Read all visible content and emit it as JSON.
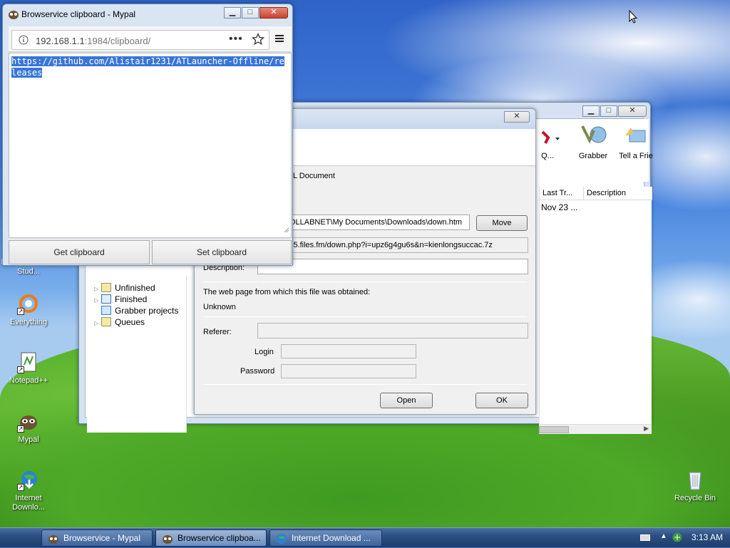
{
  "desktop": {
    "icons": [
      {
        "label": "Microsoft Visual Stud...",
        "icon": "visual-studio-icon"
      },
      {
        "label": "Everything",
        "icon": "everything-icon"
      },
      {
        "label": "Notepad++",
        "icon": "notepadpp-icon"
      },
      {
        "label": "Mypal",
        "icon": "mypal-icon"
      },
      {
        "label": "Internet Downlo...",
        "icon": "idm-icon"
      },
      {
        "label": "Recycle Bin",
        "icon": "recycle-bin-icon"
      }
    ]
  },
  "clipboard_window": {
    "title": "Browservice clipboard - Mypal",
    "url_host": "192.168.1.1",
    "url_rest": ":1984/clipboard/",
    "clipboard_text": "https://github.com/Alistair1231/ATLauncher-Offline/releases",
    "get_button": "Get clipboard",
    "set_button": "Set clipboard"
  },
  "idm_window": {
    "toolbar": [
      {
        "label": "Q...",
        "icon": "queue-icon"
      },
      {
        "label": "Grabber",
        "icon": "grabber-icon"
      },
      {
        "label": "Tell a Frie",
        "icon": "tell-friend-icon"
      }
    ],
    "columns": [
      "Last Tr...",
      "Description"
    ],
    "row_last_try": "Nov 23 ...",
    "tree": [
      "Unfinished",
      "Finished",
      "Grabber projects",
      "Queues"
    ]
  },
  "properties_dialog": {
    "type_text": "L Document",
    "save_path": "COLLABNET\\My Documents\\Downloads\\down.htm",
    "move_button": "Move",
    "address": "-5-5.files.fm/down.php?i=upz6g4gu6s&n=kienlongsuccac.7z",
    "description_label": "Description:",
    "description_value": "",
    "source_page_label": "The web page from which this file was obtained:",
    "source_page_value": "Unknown",
    "referer_label": "Referer:",
    "login_label": "Login",
    "password_label": "Password",
    "open_button": "Open",
    "ok_button": "OK"
  },
  "taskbar": {
    "tasks": [
      {
        "label": "Browservice - Mypal",
        "active": false
      },
      {
        "label": "Browservice clipboa...",
        "active": true
      },
      {
        "label": "Internet Download ...",
        "active": false
      }
    ],
    "clock": "3:13 AM"
  },
  "colors": {
    "selection": "#3875d7",
    "taskbar": "#2c4f82"
  }
}
